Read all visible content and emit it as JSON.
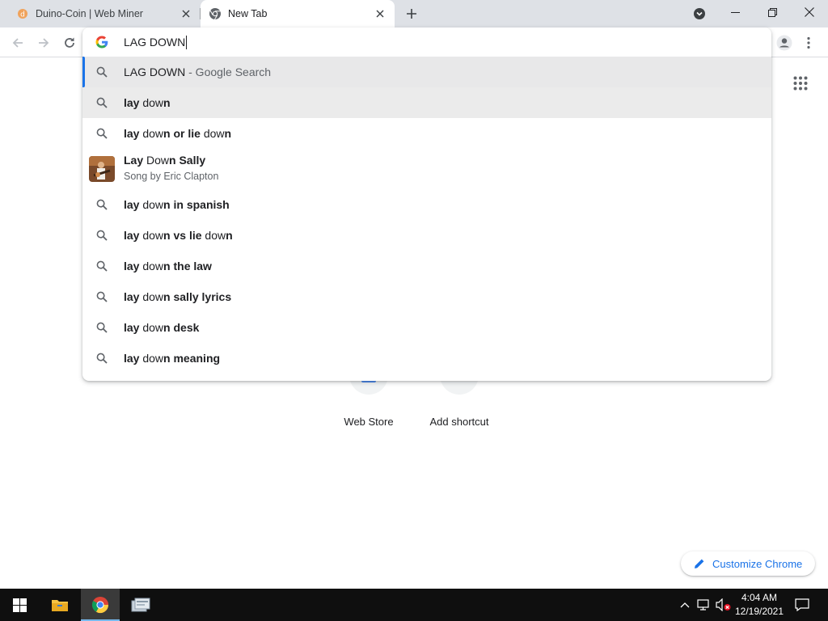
{
  "browser": {
    "tabs": [
      {
        "title": "Duino-Coin | Web Miner",
        "active": false,
        "favicon": "duino-coin-icon"
      },
      {
        "title": "New Tab",
        "active": true,
        "favicon": "chrome-icon"
      }
    ]
  },
  "omnibox": {
    "input_value": "LAG DOWN",
    "suggestions": [
      {
        "type": "search-what-you-typed",
        "text": "LAG DOWN",
        "description": " - Google Search",
        "icon": "search-icon"
      },
      {
        "type": "search",
        "parts": [
          {
            "t": "lay",
            "b": true
          },
          {
            "t": " dow",
            "b": false
          },
          {
            "t": "n",
            "b": true
          }
        ],
        "icon": "search-icon"
      },
      {
        "type": "search",
        "parts": [
          {
            "t": "lay",
            "b": true
          },
          {
            "t": " dow",
            "b": false
          },
          {
            "t": "n or lie ",
            "b": true
          },
          {
            "t": "dow",
            "b": false
          },
          {
            "t": "n",
            "b": true
          }
        ],
        "icon": "search-icon"
      },
      {
        "type": "entity",
        "parts": [
          {
            "t": "Lay",
            "b": true
          },
          {
            "t": " Dow",
            "b": false
          },
          {
            "t": "n Sally",
            "b": true
          }
        ],
        "subtitle": "Song by Eric Clapton",
        "icon": "album-thumbnail"
      },
      {
        "type": "search",
        "parts": [
          {
            "t": "lay",
            "b": true
          },
          {
            "t": " dow",
            "b": false
          },
          {
            "t": "n in spanish",
            "b": true
          }
        ],
        "icon": "search-icon"
      },
      {
        "type": "search",
        "parts": [
          {
            "t": "lay",
            "b": true
          },
          {
            "t": " dow",
            "b": false
          },
          {
            "t": "n vs lie ",
            "b": true
          },
          {
            "t": "dow",
            "b": false
          },
          {
            "t": "n",
            "b": true
          }
        ],
        "icon": "search-icon"
      },
      {
        "type": "search",
        "parts": [
          {
            "t": "lay",
            "b": true
          },
          {
            "t": " dow",
            "b": false
          },
          {
            "t": "n the law",
            "b": true
          }
        ],
        "icon": "search-icon"
      },
      {
        "type": "search",
        "parts": [
          {
            "t": "lay",
            "b": true
          },
          {
            "t": " dow",
            "b": false
          },
          {
            "t": "n sally lyrics",
            "b": true
          }
        ],
        "icon": "search-icon"
      },
      {
        "type": "search",
        "parts": [
          {
            "t": "lay",
            "b": true
          },
          {
            "t": " dow",
            "b": false
          },
          {
            "t": "n desk",
            "b": true
          }
        ],
        "icon": "search-icon"
      },
      {
        "type": "search",
        "parts": [
          {
            "t": "lay",
            "b": true
          },
          {
            "t": " dow",
            "b": false
          },
          {
            "t": "n meaning",
            "b": true
          }
        ],
        "icon": "search-icon"
      }
    ]
  },
  "ntp": {
    "shortcuts": [
      {
        "label": "Web Store",
        "icon": "web-store-icon"
      },
      {
        "label": "Add shortcut",
        "icon": "plus-icon"
      }
    ],
    "customize_label": "Customize Chrome"
  },
  "taskbar": {
    "time": "4:04 AM",
    "date": "12/19/2021"
  },
  "colors": {
    "accent": "#1a73e8",
    "tabstrip": "#dee1e6",
    "selection": "#e8e8e9",
    "taskbar": "#0f0f0f"
  }
}
